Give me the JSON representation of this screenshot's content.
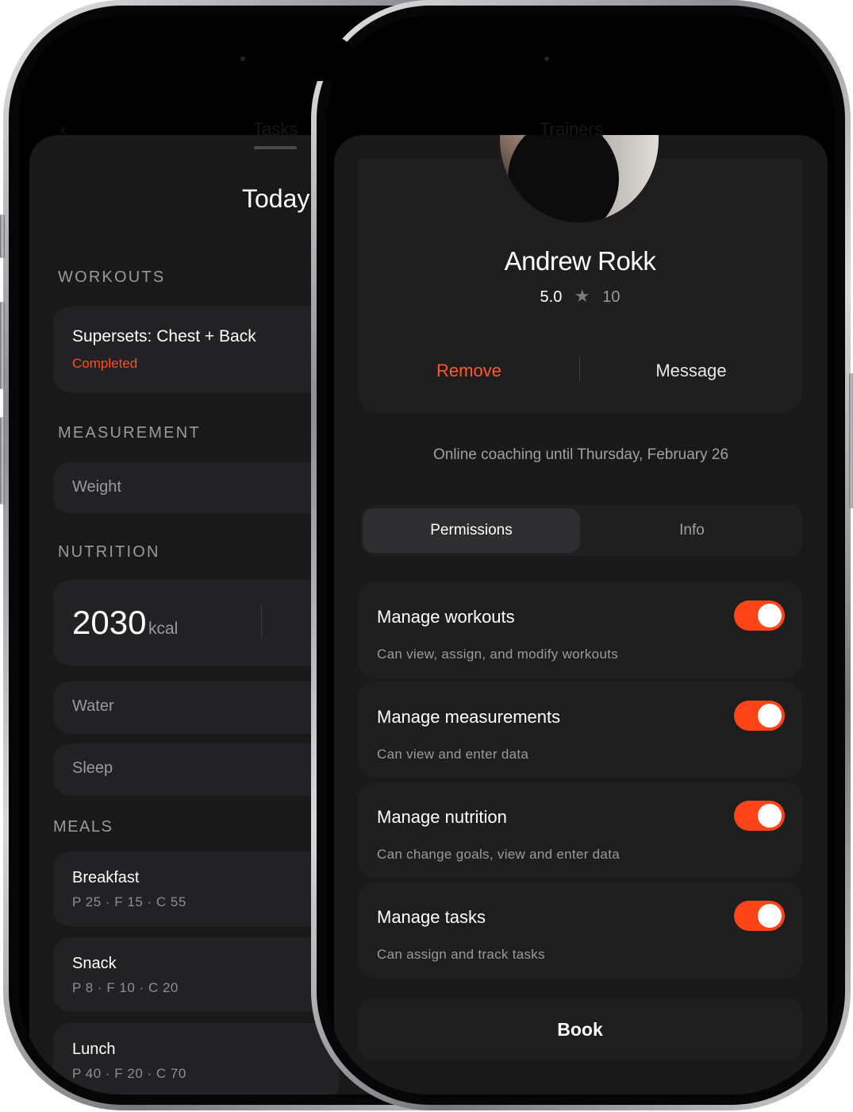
{
  "left_screen": {
    "nav_title": "Tasks",
    "sheet_title": "Today",
    "workouts": {
      "header": "WORKOUTS",
      "item": {
        "title": "Supersets: Chest + Back",
        "status": "Completed"
      }
    },
    "measurement": {
      "header": "MEASUREMENT",
      "item": "Weight"
    },
    "nutrition": {
      "header": "NUTRITION",
      "calories": "2030",
      "unit": "kcal",
      "water": "Water",
      "sleep": "Sleep"
    },
    "meals": {
      "header": "MEALS",
      "items": [
        {
          "name": "Breakfast",
          "macros": "P 25  ·  F 15  ·  C 55"
        },
        {
          "name": "Snack",
          "macros": "P 8  ·  F 10  ·  C 20"
        },
        {
          "name": "Lunch",
          "macros": "P 40  ·  F 20  ·  C 70"
        }
      ]
    }
  },
  "right_screen": {
    "nav_title": "Trainers",
    "profile": {
      "name": "Andrew Rokk",
      "rating": "5.0",
      "review_count": "10",
      "remove_label": "Remove",
      "message_label": "Message"
    },
    "coaching_note": "Online coaching until Thursday, February 26",
    "tabs": {
      "permissions": "Permissions",
      "info": "Info",
      "selected": "Permissions"
    },
    "permissions": [
      {
        "title": "Manage workouts",
        "description": "Can view, assign, and modify workouts",
        "enabled": true
      },
      {
        "title": "Manage measurements",
        "description": "Can view and enter data",
        "enabled": true
      },
      {
        "title": "Manage nutrition",
        "description": "Can change goals, view and enter data",
        "enabled": true
      },
      {
        "title": "Manage tasks",
        "description": "Can assign and track tasks",
        "enabled": true
      }
    ],
    "book_label": "Book"
  },
  "colors": {
    "accent": "#ff4418",
    "remove_text": "#ff5a2c",
    "background": "#191919",
    "card": "#1e1e1e"
  }
}
